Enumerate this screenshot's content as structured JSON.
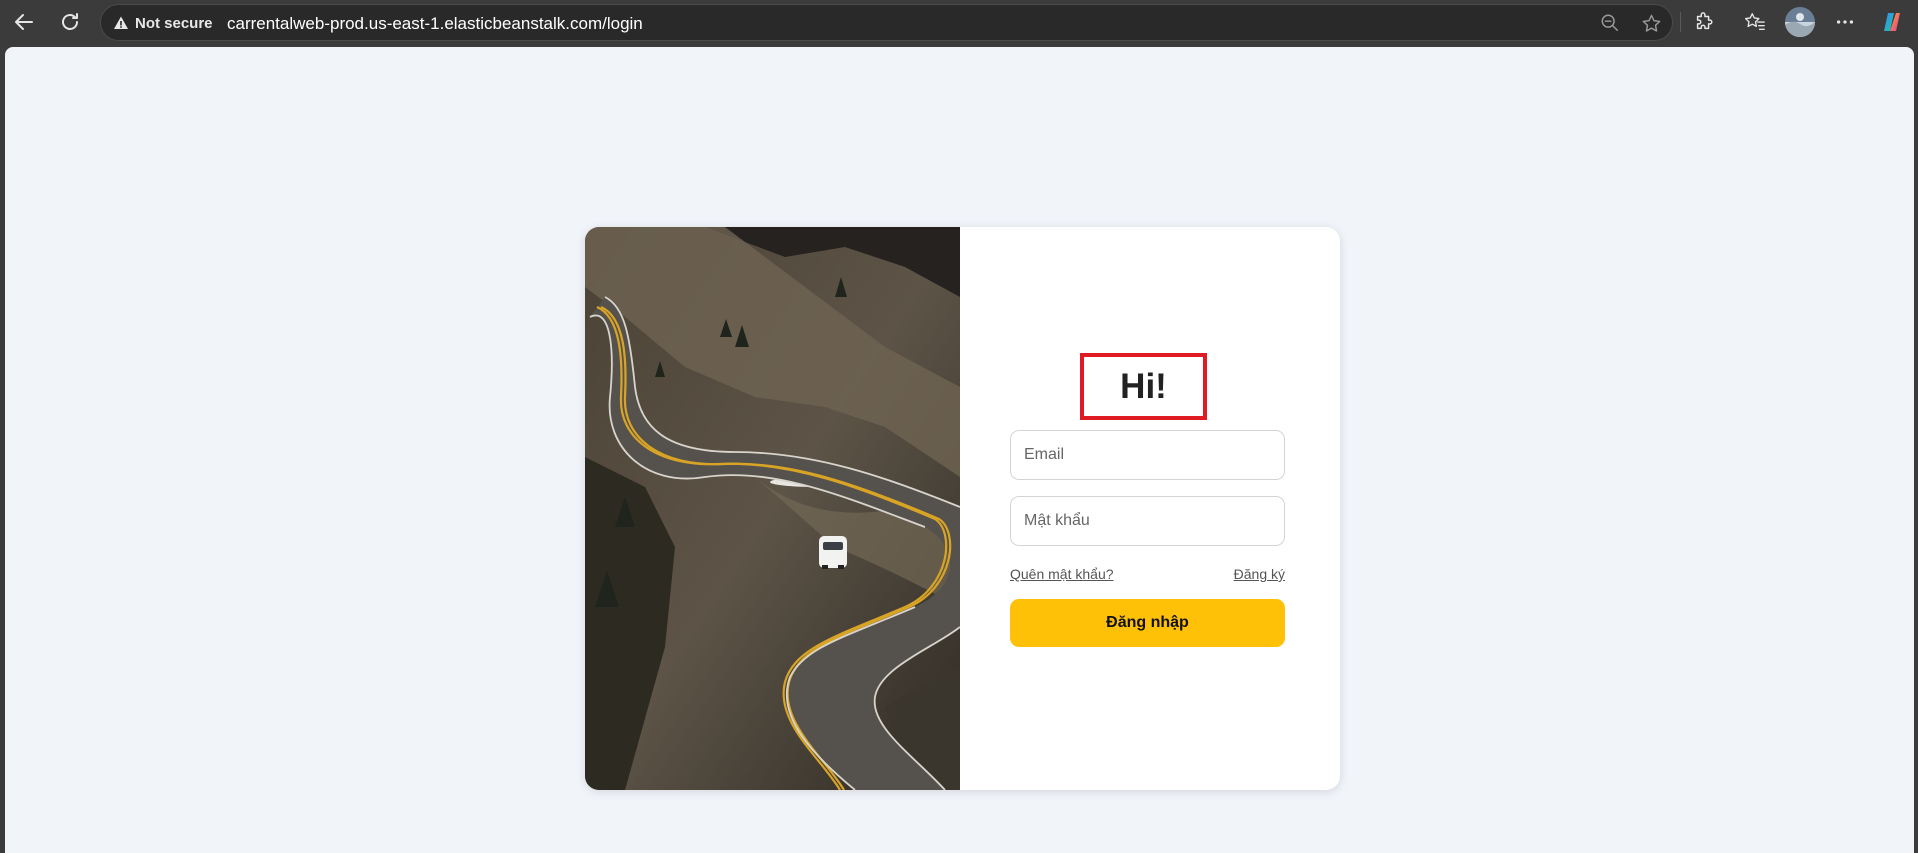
{
  "browser": {
    "security_label": "Not secure",
    "url": "carrentalweb-prod.us-east-1.elasticbeanstalk.com/login",
    "icons": [
      "back-icon",
      "reload-icon",
      "warning-icon",
      "zoom-out-icon",
      "star-icon",
      "extensions-icon",
      "favorites-icon",
      "profile-avatar",
      "more-icon",
      "copilot-icon"
    ]
  },
  "login": {
    "greeting": "Hi!",
    "email_placeholder": "Email",
    "password_placeholder": "Mật khẩu",
    "forgot_password": "Quên mật khẩu?",
    "register": "Đăng ký",
    "submit": "Đăng nhập"
  },
  "colors": {
    "page_background": "#f1f5fa",
    "button": "#ffc107",
    "highlight_box": "#e01b24",
    "browser_chrome": "#3b3b3b"
  }
}
